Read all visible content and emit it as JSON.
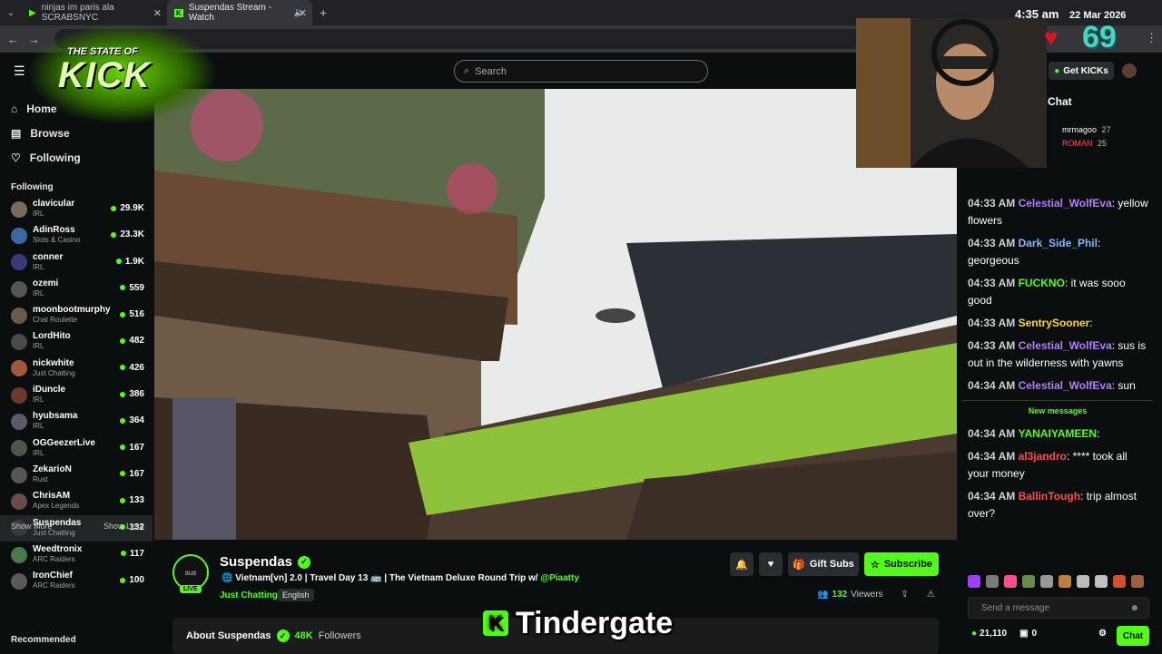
{
  "browser": {
    "tabs": [
      {
        "title": "ninjas im paris ala SCRABSNYC",
        "active": false
      },
      {
        "title": "Suspendas Stream - Watch",
        "active": true
      }
    ]
  },
  "overlay": {
    "logo_line1": "THE STATE OF",
    "logo_line2": "KICK",
    "clock_time": "4:35 am",
    "clock_date": "22 Mar 2026",
    "counter": "69",
    "caption": "Tindergate"
  },
  "header": {
    "search_placeholder": "Search",
    "get_kicks": "Get KICKs"
  },
  "sidebar": {
    "nav": [
      {
        "label": "Home",
        "icon": "home-icon"
      },
      {
        "label": "Browse",
        "icon": "browse-icon"
      },
      {
        "label": "Following",
        "icon": "heart-icon"
      }
    ],
    "following_title": "Following",
    "following": [
      {
        "name": "clavicular",
        "category": "IRL",
        "viewers": "29.9K"
      },
      {
        "name": "AdinRoss",
        "category": "Slots & Casino",
        "viewers": "23.3K"
      },
      {
        "name": "conner",
        "category": "IRL",
        "viewers": "1.9K"
      },
      {
        "name": "ozemi",
        "category": "IRL",
        "viewers": "559"
      },
      {
        "name": "moonbootmurphy",
        "category": "Chat Roulette",
        "viewers": "516"
      },
      {
        "name": "LordHito",
        "category": "IRL",
        "viewers": "482"
      },
      {
        "name": "nickwhite",
        "category": "Just Chatting",
        "viewers": "426"
      },
      {
        "name": "iDuncle",
        "category": "IRL",
        "viewers": "386"
      },
      {
        "name": "hyubsama",
        "category": "IRL",
        "viewers": "364"
      },
      {
        "name": "OGGeezerLive",
        "category": "IRL",
        "viewers": "167"
      },
      {
        "name": "ZekarioN",
        "category": "Rust",
        "viewers": "167"
      },
      {
        "name": "ChrisAM",
        "category": "Apex Legends",
        "viewers": "133"
      },
      {
        "name": "Suspendas",
        "category": "Just Chatting",
        "viewers": "132"
      },
      {
        "name": "Weedtronix",
        "category": "ARC Raiders",
        "viewers": "117"
      },
      {
        "name": "IronChief",
        "category": "ARC Raiders",
        "viewers": "100"
      }
    ],
    "show_more": "Show More",
    "show_less": "Show Less",
    "recommended": "Recommended"
  },
  "stream": {
    "channel": "Suspendas",
    "avatar_text": "sus",
    "live": "LIVE",
    "title": "Vietnam[vn] 2.0 | Travel Day 13 🚌 | The Vietnam Deluxe Round Trip w/",
    "mention": "@Piaatty",
    "category": "Just Chatting",
    "language": "English",
    "gift_subs": "Gift Subs",
    "subscribe": "Subscribe",
    "viewers_count": "132",
    "viewers_label": "Viewers",
    "about_label": "About Suspendas",
    "followers_count": "48K",
    "followers_label": "Followers"
  },
  "chat": {
    "title": "Chat",
    "pinned": [
      {
        "name": "mrmagoo",
        "count": "27"
      },
      {
        "name": "ROMAN",
        "count": "25"
      }
    ],
    "messages": [
      {
        "time": "04:33 AM",
        "user": "Celestial_WolfEva",
        "color": "#b57cff",
        "text": "yellow flowers"
      },
      {
        "time": "04:33 AM",
        "user": "Dark_Side_Phil",
        "color": "#7fb8ff",
        "text": "georgeous"
      },
      {
        "time": "04:33 AM",
        "user": "FUCKNO",
        "color": "#53fc18",
        "text": "it was sooo good"
      },
      {
        "time": "04:33 AM",
        "user": "SentrySooner",
        "color": "#ffd23f",
        "text": ""
      },
      {
        "time": "04:33 AM",
        "user": "Celestial_WolfEva",
        "color": "#b57cff",
        "text": "sus is out in the wilderness with yawns"
      },
      {
        "time": "04:34 AM",
        "user": "Celestial_WolfEva",
        "color": "#b57cff",
        "text": "sun"
      }
    ],
    "new_messages": "New messages",
    "new": [
      {
        "time": "04:34 AM",
        "user": "YANAIYAMEEN",
        "color": "#53fc18",
        "text": ""
      },
      {
        "time": "04:34 AM",
        "user": "al3jandro",
        "color": "#ff4d4d",
        "text": "**** took all your money"
      },
      {
        "time": "04:34 AM",
        "user": "BallinTough",
        "color": "#ff4d4d",
        "text": "trip almost over?"
      }
    ],
    "input_placeholder": "Send a message",
    "kicks_balance": "21,110",
    "gift_count": "0",
    "send_button": "Chat"
  }
}
